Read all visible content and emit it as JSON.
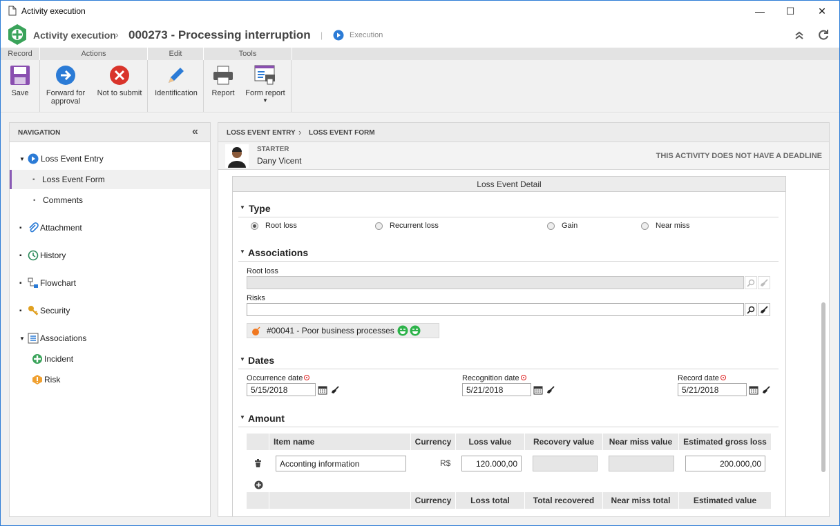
{
  "window": {
    "title": "Activity execution",
    "minimize": "—",
    "maximize": "☐",
    "close": "✕"
  },
  "header": {
    "app_name": "Activity execution",
    "record_title": "000273 - Processing interruption",
    "separator": "|",
    "status": "Execution"
  },
  "ribbon": {
    "groups": [
      "Record",
      "Actions",
      "Edit",
      "Tools"
    ],
    "save": "Save",
    "forward": "Forward for approval",
    "not_submit": "Not to submit",
    "identification": "Identification",
    "report": "Report",
    "form_report": "Form report"
  },
  "navigation": {
    "title": "NAVIGATION",
    "items": [
      {
        "label": "Loss Event Entry"
      },
      {
        "label": "Loss Event Form"
      },
      {
        "label": "Comments"
      },
      {
        "label": "Attachment"
      },
      {
        "label": "History"
      },
      {
        "label": "Flowchart"
      },
      {
        "label": "Security"
      },
      {
        "label": "Associations"
      },
      {
        "label": "Incident"
      },
      {
        "label": "Risk"
      }
    ]
  },
  "breadcrumb": [
    "LOSS EVENT ENTRY",
    "LOSS EVENT FORM"
  ],
  "starter": {
    "label": "STARTER",
    "name": "Dany Vicent",
    "deadline": "THIS ACTIVITY DOES NOT HAVE A DEADLINE"
  },
  "form": {
    "panel_title": "Loss Event Detail",
    "type": {
      "title": "Type",
      "options": [
        "Root loss",
        "Recurrent loss",
        "Gain",
        "Near miss"
      ],
      "selected": "Root loss"
    },
    "associations": {
      "title": "Associations",
      "root_loss_label": "Root loss",
      "root_loss_value": "",
      "risks_label": "Risks",
      "risks_value": "",
      "risk_tag": "#00041 - Poor business processes"
    },
    "dates": {
      "title": "Dates",
      "occurrence_label": "Occurrence date",
      "occurrence_value": "5/15/2018",
      "recognition_label": "Recognition date",
      "recognition_value": "5/21/2018",
      "record_label": "Record date",
      "record_value": "5/21/2018"
    },
    "amount": {
      "title": "Amount",
      "columns": [
        "Item name",
        "Currency",
        "Loss value",
        "Recovery value",
        "Near miss value",
        "Estimated gross loss"
      ],
      "row": {
        "item_name": "Acconting information",
        "currency": "R$",
        "loss_value": "120.000,00",
        "recovery_value": "",
        "near_miss_value": "",
        "estimated_gross_loss": "200.000,00"
      },
      "total_columns": [
        "Currency",
        "Loss total",
        "Total recovered",
        "Near miss total",
        "Estimated value"
      ]
    }
  },
  "colors": {
    "accent": "#2b7bd6",
    "nav_selected": "#8a5bb5",
    "cancel_red": "#d9342b",
    "happy_green": "#2db34a"
  }
}
